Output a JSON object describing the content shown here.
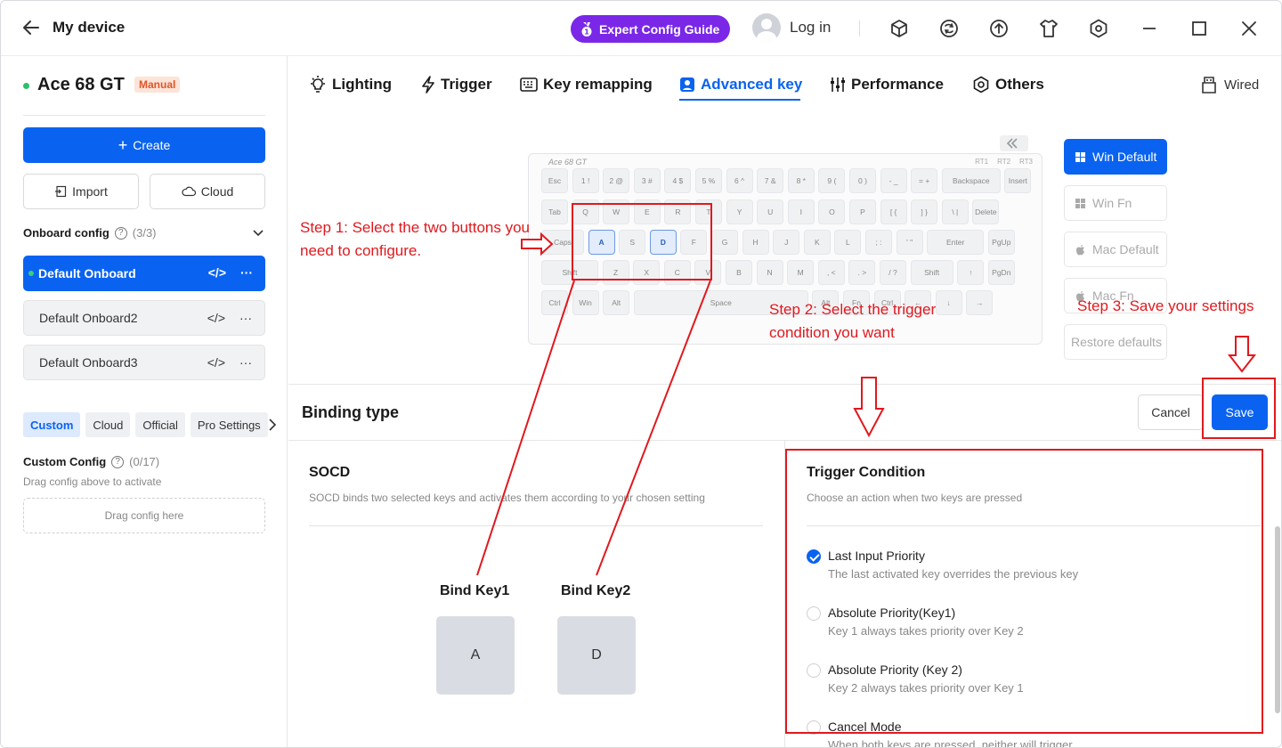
{
  "header": {
    "title": "My device",
    "guide_label": "Expert Config Guide",
    "login_label": "Log in"
  },
  "sidebar": {
    "device_name": "Ace 68 GT",
    "mode_badge": "Manual",
    "create_label": "Create",
    "import_label": "Import",
    "cloud_label": "Cloud",
    "onboard_title": "Onboard config",
    "onboard_count": "(3/3)",
    "onboard_items": [
      {
        "label": "Default Onboard"
      },
      {
        "label": "Default Onboard2"
      },
      {
        "label": "Default Onboard3"
      }
    ],
    "tags": [
      "Custom",
      "Cloud",
      "Official",
      "Pro Settings"
    ],
    "custom_title": "Custom Config",
    "custom_count": "(0/17)",
    "custom_hint": "Drag config above to activate",
    "drop_label": "Drag config here"
  },
  "tabs": {
    "items": [
      "Lighting",
      "Trigger",
      "Key remapping",
      "Advanced key",
      "Performance",
      "Others"
    ],
    "active": "Advanced key",
    "connection": "Wired"
  },
  "keyboard": {
    "model_label": "Ace 68 GT",
    "profiles": [
      "RT1",
      "RT2",
      "RT3"
    ],
    "rows": [
      [
        "Esc",
        "1 !",
        "2 @",
        "3 #",
        "4 $",
        "5 %",
        "6 ^",
        "7 &",
        "8 *",
        "9 (",
        "0 )",
        "- _",
        "= +",
        "Backspace",
        "Insert"
      ],
      [
        "Tab",
        "Q",
        "W",
        "E",
        "R",
        "T",
        "Y",
        "U",
        "I",
        "O",
        "P",
        "[ {",
        "] }",
        "\\ |",
        "Delete"
      ],
      [
        "Caps",
        "A",
        "S",
        "D",
        "F",
        "G",
        "H",
        "J",
        "K",
        "L",
        "; :",
        "' \"",
        "Enter",
        "PgUp"
      ],
      [
        "Shift",
        "Z",
        "X",
        "C",
        "V",
        "B",
        "N",
        "M",
        ", <",
        ". >",
        "/ ?",
        "Shift",
        "↑",
        "PgDn"
      ],
      [
        "Ctrl",
        "Win",
        "Alt",
        "Space",
        "Alt",
        "Fn",
        "Ctrl",
        "←",
        "↓",
        "→"
      ]
    ],
    "selected_keys": [
      "A",
      "D"
    ]
  },
  "platforms": [
    {
      "label": "Win Default",
      "active": true
    },
    {
      "label": "Win Fn",
      "active": false
    },
    {
      "label": "Mac Default",
      "active": false
    },
    {
      "label": "Mac Fn",
      "active": false
    },
    {
      "label": "Restore defaults",
      "active": false
    }
  ],
  "binding": {
    "title": "Binding type",
    "cancel_label": "Cancel",
    "save_label": "Save",
    "socd_title": "SOCD",
    "socd_desc": "SOCD binds two selected keys and activates them according to your chosen setting",
    "bind_key1_label": "Bind Key1",
    "bind_key1_value": "A",
    "bind_key2_label": "Bind Key2",
    "bind_key2_value": "D"
  },
  "trigger": {
    "title": "Trigger Condition",
    "desc": "Choose an action when two keys are pressed",
    "options": [
      {
        "label": "Last Input Priority",
        "desc": "The last activated key overrides the previous key",
        "checked": true
      },
      {
        "label": "Absolute Priority(Key1)",
        "desc": "Key 1 always takes priority over Key 2",
        "checked": false
      },
      {
        "label": "Absolute Priority (Key 2)",
        "desc": "Key 2 always takes priority over Key 1",
        "checked": false
      },
      {
        "label": "Cancel Mode",
        "desc": "When both keys are pressed, neither will trigger",
        "checked": false
      }
    ]
  },
  "annotations": {
    "step1": "Step 1: Select the two buttons you need to configure.",
    "step2": "Step 2: Select the trigger condition you want",
    "step3": "Step 3: Save your settings"
  },
  "colors": {
    "accent": "#0a63f0",
    "guide": "#7a27e8",
    "annotation": "#e0191e",
    "badge_bg": "#fde4d8",
    "badge_text": "#e0562a"
  },
  "icons": {
    "back": "arrow-left-icon",
    "guide": "medal-icon",
    "toolbar": [
      "cube-icon",
      "refresh-globe-icon",
      "upload-icon",
      "tshirt-icon",
      "settings-hex-icon"
    ],
    "window": [
      "minimize-icon",
      "maximize-icon",
      "close-icon"
    ]
  }
}
